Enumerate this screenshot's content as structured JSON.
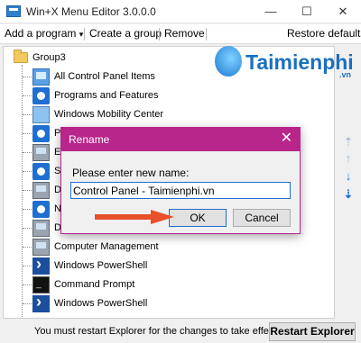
{
  "window": {
    "title": "Win+X Menu Editor 3.0.0.0",
    "minimize": "—",
    "maximize": "☐",
    "close": "✕"
  },
  "menu": {
    "add_program": "Add a program",
    "add_program_caret": "▾",
    "create_group": "Create a group",
    "remove": "Remove",
    "restore_defaults": "Restore defaults"
  },
  "tree": {
    "group": "Group3",
    "items": [
      {
        "label": "All Control Panel Items",
        "icon": "control-panel-icon"
      },
      {
        "label": "Programs and Features",
        "icon": "gear-icon"
      },
      {
        "label": "Windows Mobility Center",
        "icon": "mobility-icon"
      },
      {
        "label": "Po",
        "icon": "gear-icon"
      },
      {
        "label": "Ev",
        "icon": "event-viewer-icon"
      },
      {
        "label": "Sy",
        "icon": "gear-icon"
      },
      {
        "label": "De",
        "icon": "device-manager-icon"
      },
      {
        "label": "Ne",
        "icon": "gear-icon"
      },
      {
        "label": "Di",
        "icon": "disk-icon"
      },
      {
        "label": "Computer Management",
        "icon": "computer-icon"
      },
      {
        "label": "Windows PowerShell",
        "icon": "powershell-icon"
      },
      {
        "label": "Command Prompt",
        "icon": "cmd-icon"
      },
      {
        "label": "Windows PowerShell",
        "icon": "powershell-icon"
      }
    ]
  },
  "side_arrows": [
    "⇡",
    "↑",
    "↓",
    "⇣"
  ],
  "status": {
    "message": "You must restart Explorer for the changes to take effect.",
    "restart_button": "Restart Explorer"
  },
  "watermark": {
    "text": "Taimienphi",
    "sub": ".vn"
  },
  "dialog": {
    "title": "Rename",
    "close": "✕",
    "prompt": "Please enter new name:",
    "value": "Control Panel - Taimienphi.vn",
    "ok": "OK",
    "cancel": "Cancel"
  },
  "colors": {
    "dialog_accent": "#b8258b",
    "pointer": "#e8502a"
  }
}
